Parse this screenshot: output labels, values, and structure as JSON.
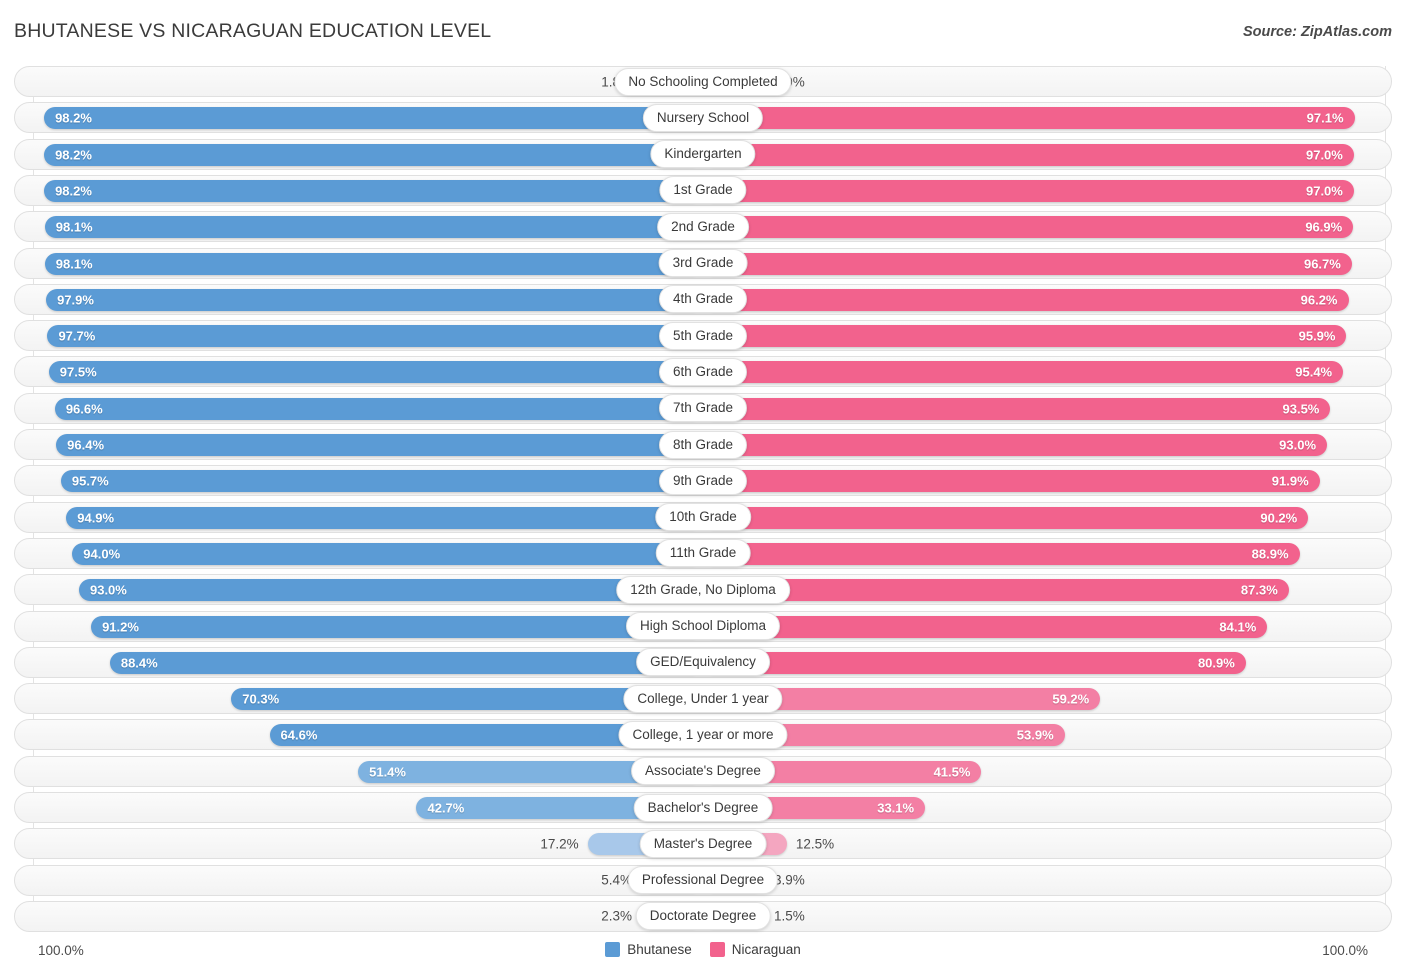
{
  "header": {
    "title": "BHUTANESE VS NICARAGUAN EDUCATION LEVEL",
    "source": "Source: ZipAtlas.com"
  },
  "footer": {
    "axis_left": "100.0%",
    "axis_right": "100.0%",
    "legend": [
      {
        "label": "Bhutanese",
        "color": "#5b9bd5"
      },
      {
        "label": "Nicaraguan",
        "color": "#f2628d"
      }
    ]
  },
  "colors": {
    "blue_strong": "#5b9bd5",
    "blue_mid": "#7eb2e0",
    "blue_light": "#a8c8ea",
    "pink_strong": "#f2628d",
    "pink_mid": "#f37fa4",
    "pink_light": "#f4a6c0"
  },
  "chart_data": {
    "type": "bar",
    "title": "BHUTANESE VS NICARAGUAN EDUCATION LEVEL",
    "orientation": "horizontal-diverging",
    "xlabel": "",
    "ylabel": "",
    "xlim": [
      0,
      100
    ],
    "grid": false,
    "legend_position": "bottom-center",
    "axis_tick_labels": [
      "100.0%",
      "100.0%"
    ],
    "categories": [
      "No Schooling Completed",
      "Nursery School",
      "Kindergarten",
      "1st Grade",
      "2nd Grade",
      "3rd Grade",
      "4th Grade",
      "5th Grade",
      "6th Grade",
      "7th Grade",
      "8th Grade",
      "9th Grade",
      "10th Grade",
      "11th Grade",
      "12th Grade, No Diploma",
      "High School Diploma",
      "GED/Equivalency",
      "College, Under 1 year",
      "College, 1 year or more",
      "Associate's Degree",
      "Bachelor's Degree",
      "Master's Degree",
      "Professional Degree",
      "Doctorate Degree"
    ],
    "series": [
      {
        "name": "Bhutanese",
        "color": "#5b9bd5",
        "values": [
          1.8,
          98.2,
          98.2,
          98.2,
          98.1,
          98.1,
          97.9,
          97.7,
          97.5,
          96.6,
          96.4,
          95.7,
          94.9,
          94.0,
          93.0,
          91.2,
          88.4,
          70.3,
          64.6,
          51.4,
          42.7,
          17.2,
          5.4,
          2.3
        ],
        "labels": [
          "1.8%",
          "98.2%",
          "98.2%",
          "98.2%",
          "98.1%",
          "98.1%",
          "97.9%",
          "97.7%",
          "97.5%",
          "96.6%",
          "96.4%",
          "95.7%",
          "94.9%",
          "94.0%",
          "93.0%",
          "91.2%",
          "88.4%",
          "70.3%",
          "64.6%",
          "51.4%",
          "42.7%",
          "17.2%",
          "5.4%",
          "2.3%"
        ]
      },
      {
        "name": "Nicaraguan",
        "color": "#f2628d",
        "values": [
          2.9,
          97.1,
          97.0,
          97.0,
          96.9,
          96.7,
          96.2,
          95.9,
          95.4,
          93.5,
          93.0,
          91.9,
          90.2,
          88.9,
          87.3,
          84.1,
          80.9,
          59.2,
          53.9,
          41.5,
          33.1,
          12.5,
          3.9,
          1.5
        ],
        "labels": [
          "2.9%",
          "97.1%",
          "97.0%",
          "97.0%",
          "96.9%",
          "96.7%",
          "96.2%",
          "95.9%",
          "95.4%",
          "93.5%",
          "93.0%",
          "91.9%",
          "90.2%",
          "88.9%",
          "87.3%",
          "84.1%",
          "80.9%",
          "59.2%",
          "53.9%",
          "41.5%",
          "33.1%",
          "12.5%",
          "3.9%",
          "1.5%"
        ]
      }
    ]
  }
}
